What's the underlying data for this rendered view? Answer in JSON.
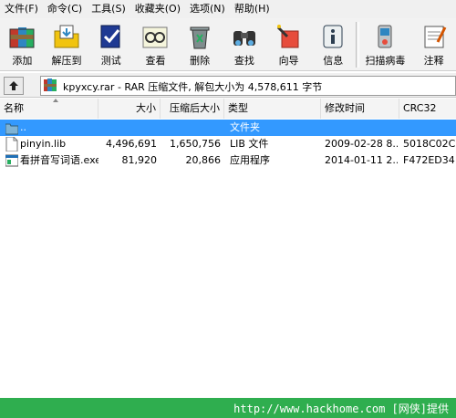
{
  "menu": [
    "文件(F)",
    "命令(C)",
    "工具(S)",
    "收藏夹(O)",
    "选项(N)",
    "帮助(H)"
  ],
  "toolbar": {
    "add": "添加",
    "extract": "解压到",
    "test": "测试",
    "view": "查看",
    "delete": "删除",
    "find": "查找",
    "wizard": "向导",
    "info": "信息",
    "scan": "扫描病毒",
    "comment": "注释"
  },
  "address": {
    "text": "kpyxcy.rar - RAR 压缩文件, 解包大小为 4,578,611 字节"
  },
  "columns": {
    "name": "名称",
    "size": "大小",
    "packed": "压缩后大小",
    "type": "类型",
    "modified": "修改时间",
    "crc": "CRC32"
  },
  "files": [
    {
      "name": "..",
      "size": "",
      "packed": "",
      "type": "文件夹",
      "modified": "",
      "crc": ""
    },
    {
      "name": "pinyin.lib",
      "size": "4,496,691",
      "packed": "1,650,756",
      "type": "LIB 文件",
      "modified": "2009-02-28 8...",
      "crc": "5018C02C"
    },
    {
      "name": "看拼音写词语.exe",
      "size": "81,920",
      "packed": "20,866",
      "type": "应用程序",
      "modified": "2014-01-11 2...",
      "crc": "F472ED34"
    }
  ],
  "status": {
    "text": "http://www.hackhome.com [网侠]提供"
  },
  "colors": {
    "selection": "#3399ff",
    "status_bg": "#2fae4f"
  }
}
